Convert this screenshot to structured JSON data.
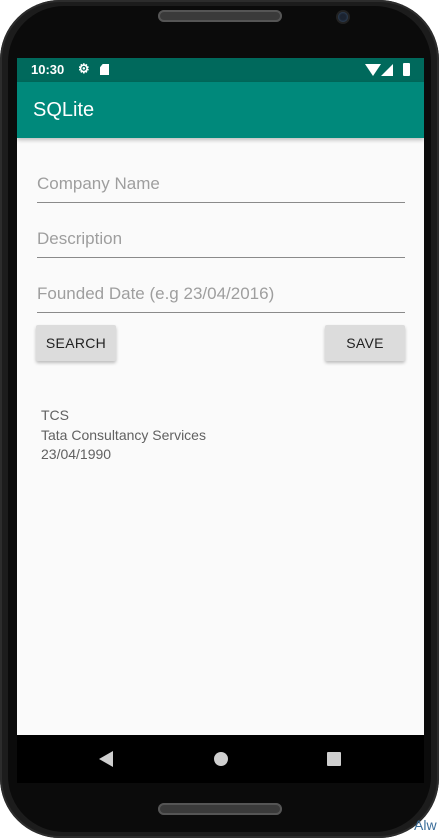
{
  "status_bar": {
    "time": "10:30",
    "icons": [
      "gear-icon",
      "sd-card-icon",
      "wifi-icon",
      "signal-icon",
      "battery-icon"
    ]
  },
  "app": {
    "title": "SQLite"
  },
  "form": {
    "company_name_placeholder": "Company Name",
    "description_placeholder": "Description",
    "founded_date_placeholder": "Founded Date (e.g 23/04/2016)"
  },
  "buttons": {
    "search_label": "SEARCH",
    "save_label": "SAVE"
  },
  "result": {
    "line1": "TCS",
    "line2": "Tata Consultancy Services",
    "line3": "23/04/1990"
  },
  "nav": {
    "icons": [
      "back-icon",
      "home-icon",
      "recent-apps-icon"
    ]
  },
  "corner_text": "Alw",
  "colors": {
    "status_bar": "#00695c",
    "app_bar": "#00897b",
    "button_bg": "#dcdcdc"
  }
}
